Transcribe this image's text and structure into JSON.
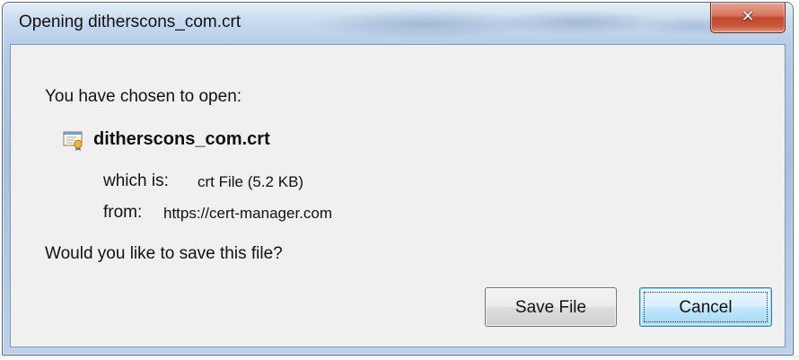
{
  "dialog": {
    "title": "Opening ditherscons_com.crt",
    "close_icon": "close-icon"
  },
  "content": {
    "prompt": "You have chosen to open:",
    "file_icon": "certificate-icon",
    "filename": "ditherscons_com.crt",
    "which_is_label": "which is:",
    "which_is_value": "crt File (5.2 KB)",
    "from_label": "from:",
    "from_value": "https://cert-manager.com",
    "question": "Would you like to save this file?"
  },
  "buttons": {
    "save_label": "Save File",
    "cancel_label": "Cancel"
  },
  "colors": {
    "close_button": "#c2462b",
    "client_background": "#f0f0f0",
    "default_button_accent": "#3c7fb1"
  }
}
